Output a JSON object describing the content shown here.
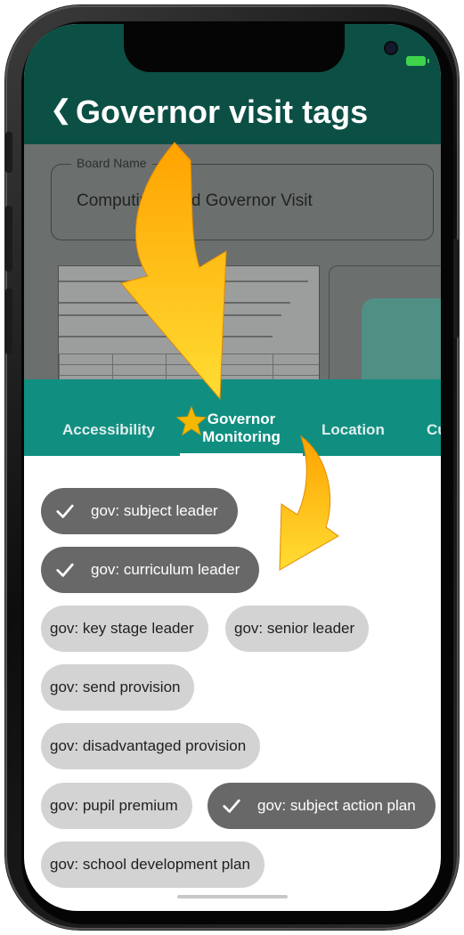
{
  "app": {
    "title": "Governor visit tags",
    "back_icon": "chevron-left-icon"
  },
  "form": {
    "board_name_label": "Board Name",
    "board_name_value": "Computing Lead Governor Visit"
  },
  "tabs": [
    {
      "label": "Accessibility",
      "active": false
    },
    {
      "label_line1": "Governor",
      "label_line2": "Monitoring",
      "active": true
    },
    {
      "label": "Location",
      "active": false
    },
    {
      "label": "Cu",
      "active": false
    }
  ],
  "tags": [
    {
      "label": "gov: subject leader",
      "selected": true
    },
    {
      "label": "gov: curriculum leader",
      "selected": true
    },
    {
      "label": "gov: key stage leader",
      "selected": false
    },
    {
      "label": "gov: senior leader",
      "selected": false
    },
    {
      "label": "gov: send provision",
      "selected": false
    },
    {
      "label": "gov: disadvantaged provision",
      "selected": false
    },
    {
      "label": "gov: pupil premium",
      "selected": false
    },
    {
      "label": "gov: subject action plan",
      "selected": true
    },
    {
      "label": "gov: school development plan",
      "selected": false
    }
  ],
  "colors": {
    "header_bg": "#0c4f45",
    "tabbar_bg": "#108f81",
    "chip_selected": "#686868",
    "chip_unselected": "#d3d3d3",
    "arrow": "#ffc107"
  }
}
